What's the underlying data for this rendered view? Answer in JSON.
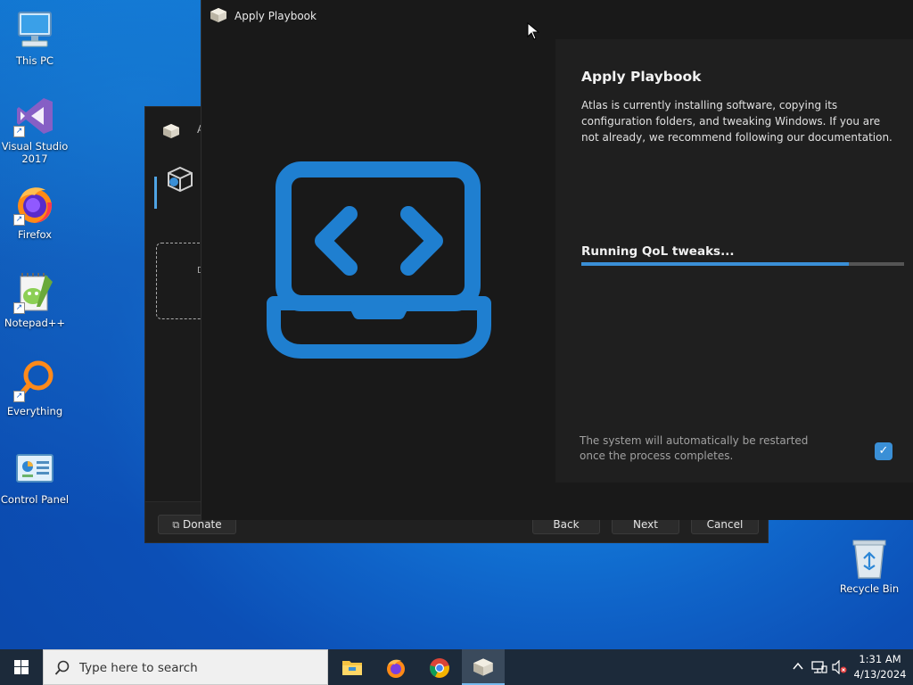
{
  "desktop": {
    "icons": [
      {
        "label": "This PC"
      },
      {
        "label": "Visual Studio 2017"
      },
      {
        "label": "Firefox"
      },
      {
        "label": "Notepad++"
      },
      {
        "label": "Everything"
      },
      {
        "label": "Control Panel"
      }
    ],
    "recycle_bin": {
      "label": "Recycle Bin"
    }
  },
  "background_window": {
    "title_partial": "A",
    "dashed_partial": "D",
    "footer": {
      "donate_label": "Donate",
      "back_label": "Back",
      "next_label": "Next",
      "cancel_label": "Cancel"
    }
  },
  "main_window": {
    "title": "Apply Playbook",
    "hero_icon": "laptop-code-icon",
    "panel": {
      "heading": "Apply Playbook",
      "description": "Atlas is currently installing software, copying its configuration folders, and tweaking Windows. If you are not already, we recommend following our documentation.",
      "status": "Running QoL tweaks...",
      "progress_percent": 83,
      "restart_note": "The system will automatically be restarted once the process completes.",
      "restart_checked": true
    }
  },
  "taskbar": {
    "search_placeholder": "Type here to search",
    "time": "1:31 AM",
    "date": "4/13/2024"
  },
  "colors": {
    "accent": "#3a8fd6",
    "window_bg": "#191919",
    "panel_bg": "#1f1f1f"
  }
}
